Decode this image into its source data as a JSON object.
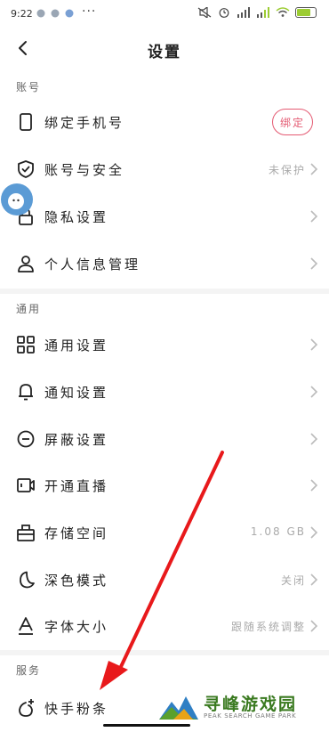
{
  "status_bar": {
    "time": "9:22",
    "more_dots": "···",
    "icons": [
      "notification-icon",
      "notification-icon",
      "notification-icon",
      "mute-icon",
      "alarm-icon",
      "hd-signal-icon",
      "hd-signal-icon",
      "wifi-icon",
      "battery-icon"
    ]
  },
  "header": {
    "title": "设置",
    "back_icon": "chevron-left-icon"
  },
  "sections": {
    "account": "账号",
    "general": "通用",
    "services": "服务"
  },
  "rows": {
    "bind_phone": {
      "label": "绑定手机号",
      "button": "绑定",
      "icon": "phone-icon"
    },
    "security": {
      "label": "账号与安全",
      "value": "未保护",
      "icon": "shield-check-icon"
    },
    "privacy": {
      "label": "隐私设置",
      "icon": "lock-icon"
    },
    "personal_info": {
      "label": "个人信息管理",
      "icon": "user-icon"
    },
    "general_settings": {
      "label": "通用设置",
      "icon": "grid-icon"
    },
    "notification_settings": {
      "label": "通知设置",
      "icon": "bell-icon"
    },
    "block_settings": {
      "label": "屏蔽设置",
      "icon": "minus-circle-icon"
    },
    "live": {
      "label": "开通直播",
      "icon": "video-icon"
    },
    "storage": {
      "label": "存储空间",
      "value": "1.08 GB",
      "icon": "storage-icon"
    },
    "dark_mode": {
      "label": "深色模式",
      "value": "关闭",
      "icon": "moon-icon"
    },
    "font_size": {
      "label": "字体大小",
      "value": "跟随系统调整",
      "icon": "font-icon"
    },
    "fans": {
      "label": "快手粉条",
      "icon": "fans-icon"
    }
  },
  "watermark": {
    "title": "寻峰游戏园",
    "subtitle": "PEAK SEARCH GAME PARK"
  },
  "colors": {
    "accent": "#e45a72",
    "arrow": "#e8191b",
    "assistant": "#5b9bd5"
  }
}
